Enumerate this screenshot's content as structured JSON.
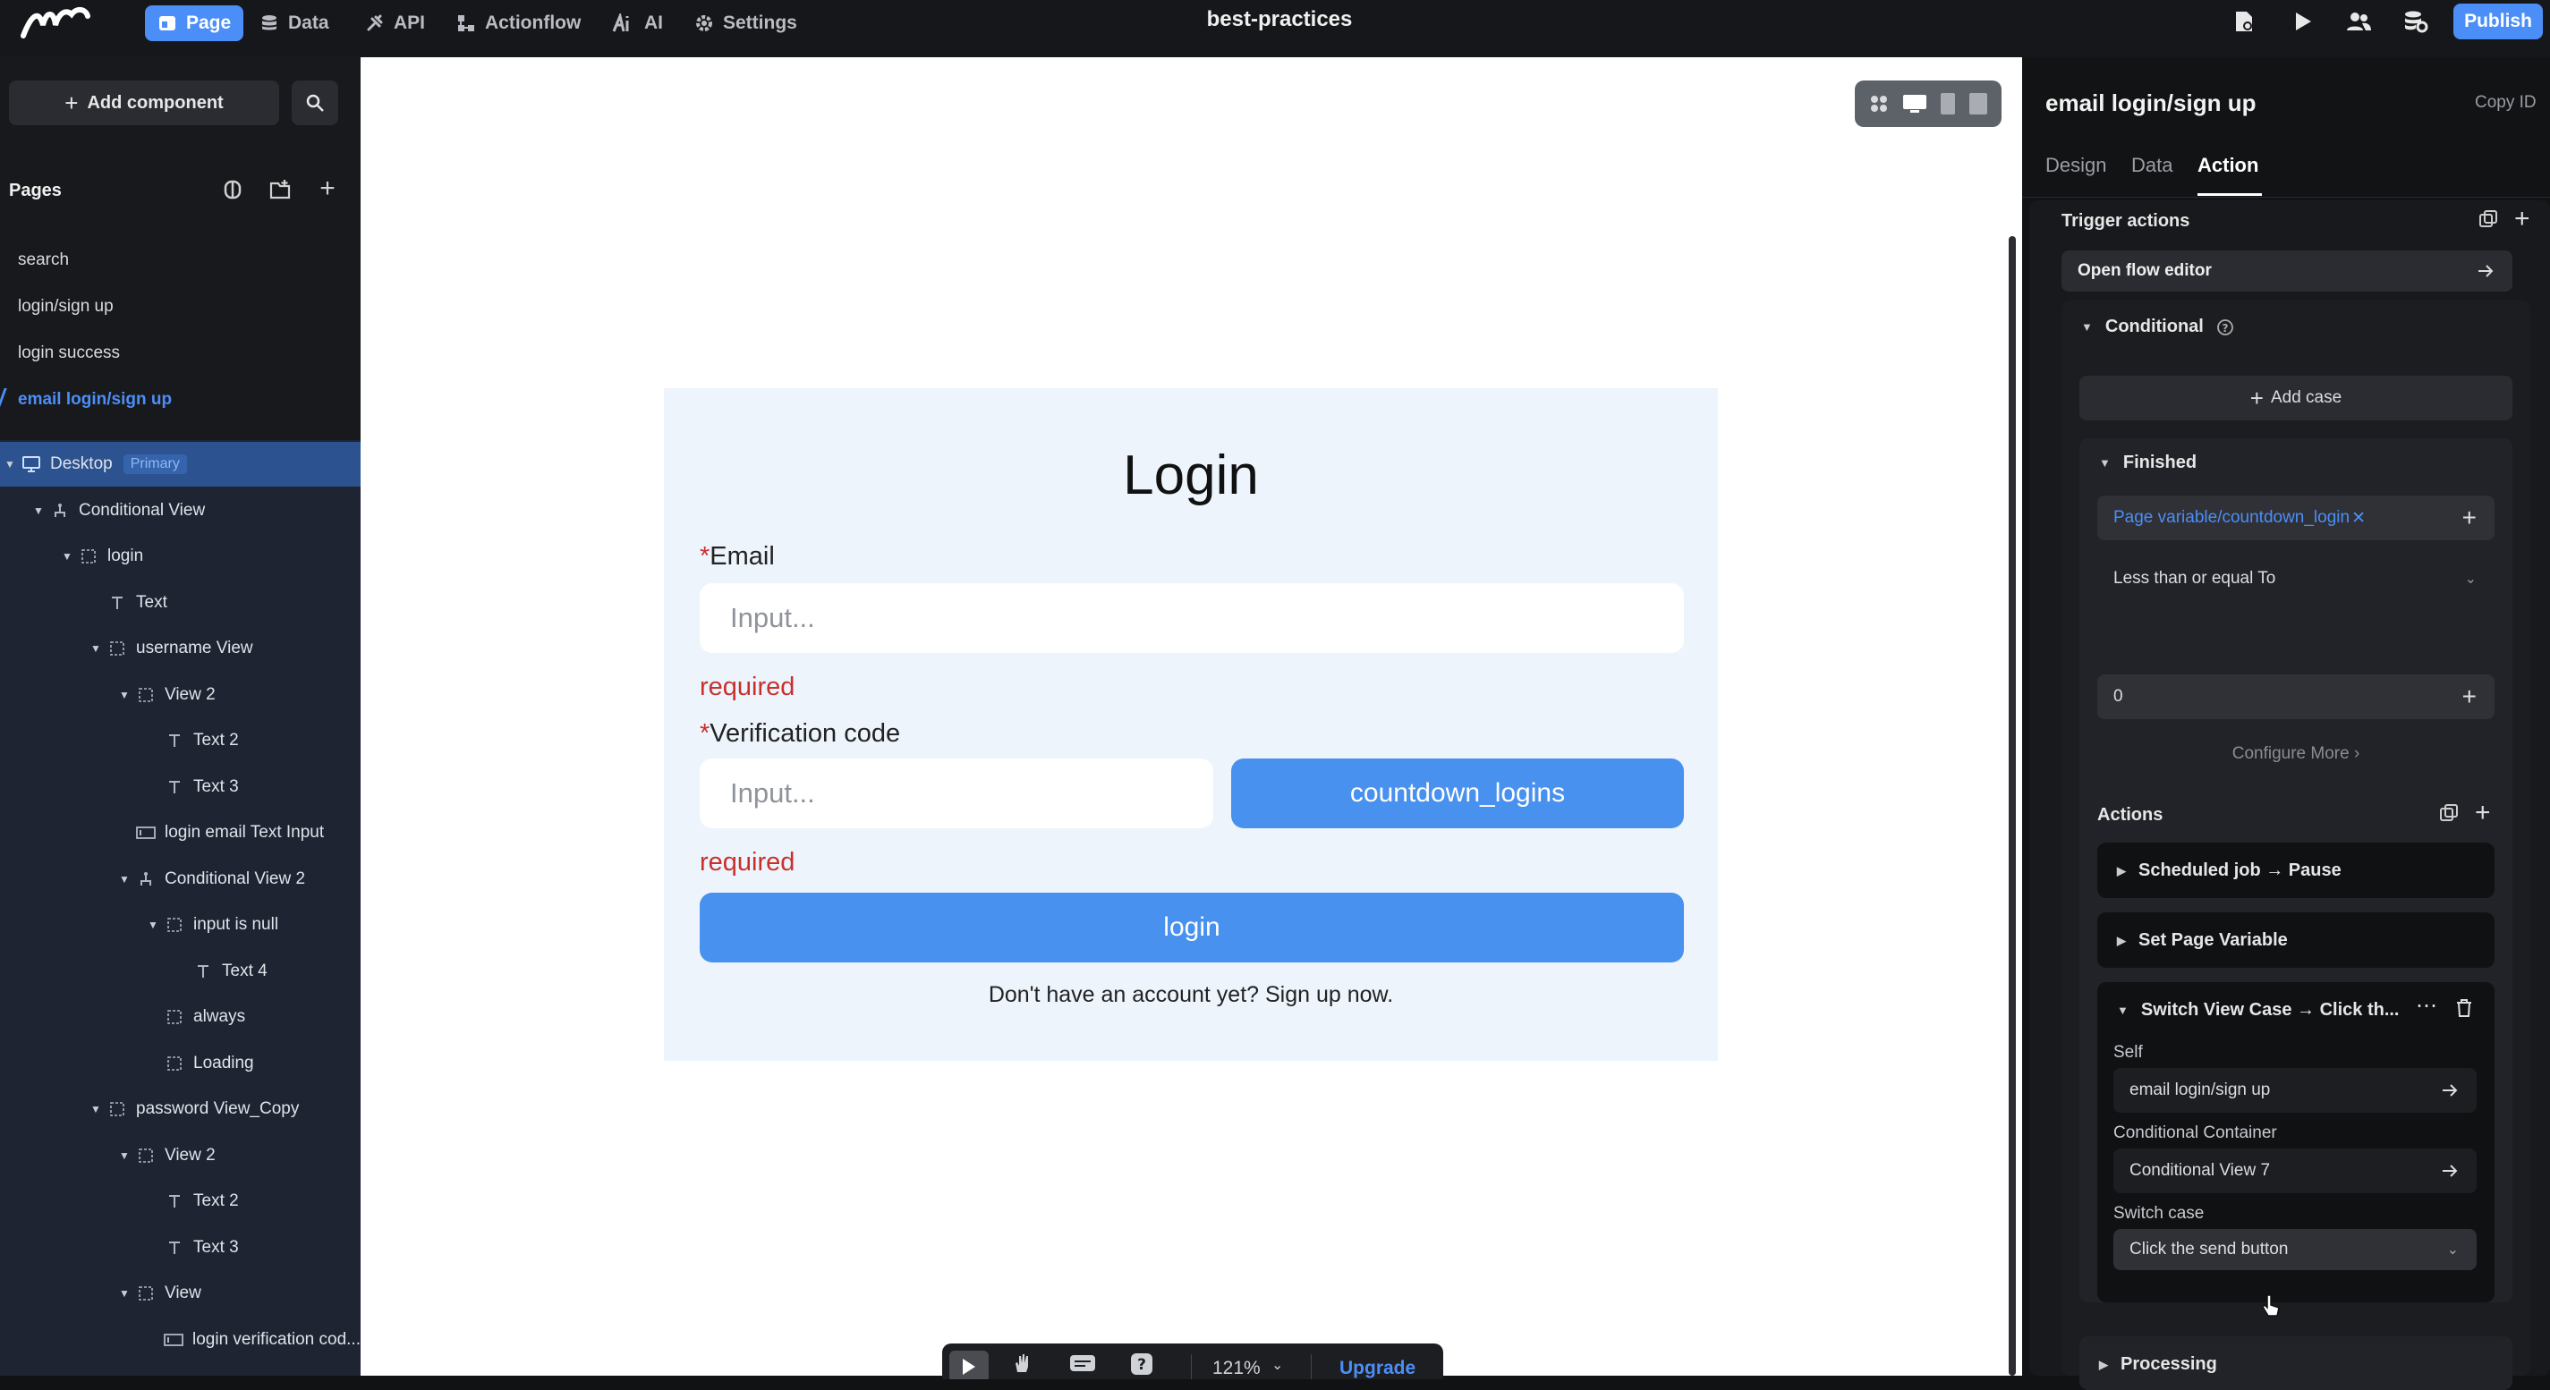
{
  "topbar": {
    "project_title": "best-practices",
    "nav": [
      {
        "label": "Page",
        "icon": "page-icon"
      },
      {
        "label": "Data",
        "icon": "database-icon"
      },
      {
        "label": "API",
        "icon": "api-icon"
      },
      {
        "label": "Actionflow",
        "icon": "actionflow-icon"
      },
      {
        "label": "AI",
        "icon": "ai-icon"
      },
      {
        "label": "Settings",
        "icon": "gear-icon"
      }
    ],
    "publish_label": "Publish"
  },
  "left": {
    "add_component_label": "Add component",
    "pages_heading": "Pages",
    "pages": [
      "search",
      "login/sign up",
      "login success",
      "email login/sign up"
    ],
    "tree": [
      {
        "label": "Desktop",
        "badge": "Primary"
      },
      {
        "label": "Conditional View"
      },
      {
        "label": "login"
      },
      {
        "label": "Text"
      },
      {
        "label": "username View"
      },
      {
        "label": "View 2"
      },
      {
        "label": "Text 2"
      },
      {
        "label": "Text 3"
      },
      {
        "label": "login email Text Input"
      },
      {
        "label": "Conditional View 2"
      },
      {
        "label": "input is null"
      },
      {
        "label": "Text 4"
      },
      {
        "label": "always"
      },
      {
        "label": "Loading"
      },
      {
        "label": "password View_Copy"
      },
      {
        "label": "View 2"
      },
      {
        "label": "Text 2"
      },
      {
        "label": "Text 3"
      },
      {
        "label": "View"
      },
      {
        "label": "login verification cod..."
      }
    ]
  },
  "canvas": {
    "form": {
      "title": "Login",
      "email_star": "*",
      "email_label": "Email",
      "email_placeholder": "Input...",
      "email_error": "required",
      "code_star": "*",
      "code_label": "Verification code",
      "code_placeholder": "Input...",
      "countdown_label": "countdown_logins",
      "code_error": "required",
      "login_label": "login",
      "signup_text": "Don't have an account yet? Sign up now."
    },
    "bottom_toolbar": {
      "zoom": "121%",
      "upgrade": "Upgrade"
    }
  },
  "right": {
    "title": "email login/sign up",
    "copy_id": "Copy ID",
    "tabs": [
      "Design",
      "Data",
      "Action"
    ],
    "active_tab": "Action",
    "trigger_actions": "Trigger actions",
    "open_flow_editor": "Open flow editor",
    "conditional": "Conditional",
    "add_case": "Add case",
    "finished": "Finished",
    "page_variable": "Page variable/countdown_login",
    "operator": "Less than or equal To",
    "compare_value": "0",
    "configure_more": "Configure More",
    "actions_heading": "Actions",
    "actions": [
      "Scheduled job → Pause",
      "Set Page Variable",
      "Switch View Case → Click th..."
    ],
    "self_label": "Self",
    "self_value": "email login/sign up",
    "container_label": "Conditional Container",
    "container_value": "Conditional View 7",
    "switch_case_label": "Switch case",
    "switch_case_value": "Click the send button",
    "processing": "Processing"
  },
  "colors": {
    "accent": "#4c8ef7",
    "form_bg": "#edf4fc",
    "error": "#c9302c",
    "tree_bg": "#1e2432"
  }
}
